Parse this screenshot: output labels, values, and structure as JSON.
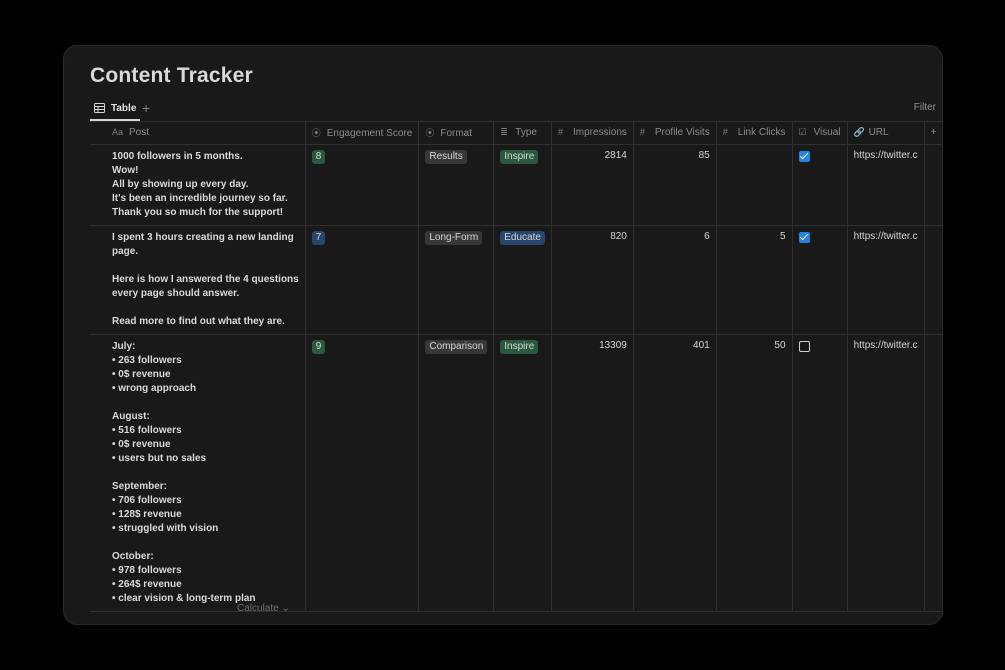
{
  "page": {
    "title": "Content Tracker"
  },
  "toolbar": {
    "view_tab_label": "Table",
    "add_view": "+",
    "filter_label": "Filter"
  },
  "columns": [
    {
      "label": "Post",
      "icon": "Aa"
    },
    {
      "label": "Engagement Score",
      "icon": "⦿"
    },
    {
      "label": "Format",
      "icon": "⦿"
    },
    {
      "label": "Type",
      "icon": "≣"
    },
    {
      "label": "Impressions",
      "icon": "#"
    },
    {
      "label": "Profile Visits",
      "icon": "#"
    },
    {
      "label": "Link Clicks",
      "icon": "#"
    },
    {
      "label": "Visual",
      "icon": "☑"
    },
    {
      "label": "URL",
      "icon": "🔗"
    },
    {
      "label": "+",
      "icon": ""
    }
  ],
  "colors": {
    "score_bg_green": "#2b593f",
    "score_bg_blue": "#28456c",
    "format_bg": "#373737",
    "type_inspire_bg": "#2b593f",
    "type_educate_bg": "#28456c",
    "checkbox_on": "#2383e2"
  },
  "rows": [
    {
      "post": [
        "1000 followers in 5 months.",
        "Wow!",
        "All by showing up every day.",
        "It's been an incredible journey so far.",
        "Thank you so much for the support!"
      ],
      "score": "8",
      "format": "Results",
      "type": "Inspire",
      "impressions": "2814",
      "profile_visits": "85",
      "link_clicks": "",
      "visual": true,
      "url": "https://twitter.c"
    },
    {
      "post": [
        "I spent 3 hours creating a new landing",
        "page.",
        "",
        "Here is how I answered the 4 questions",
        "every page should answer.",
        "",
        "Read more to find out what they are."
      ],
      "score": "7",
      "format": "Long-Form",
      "type": "Educate",
      "impressions": "820",
      "profile_visits": "6",
      "link_clicks": "5",
      "visual": true,
      "url": "https://twitter.c"
    },
    {
      "post": [
        "July:",
        "• 263 followers",
        "• 0$ revenue",
        "• wrong approach",
        "",
        "August:",
        "• 516 followers",
        "• 0$ revenue",
        "• users but no sales",
        "",
        "September:",
        "• 706 followers",
        "• 128$ revenue",
        "• struggled with vision",
        "",
        "October:",
        "• 978 followers",
        "• 264$ revenue",
        "• clear vision & long-term plan"
      ],
      "score": "9",
      "format": "Comparison",
      "type": "Inspire",
      "impressions": "13309",
      "profile_visits": "401",
      "link_clicks": "50",
      "visual": false,
      "url": "https://twitter.c"
    }
  ],
  "footer": {
    "calculate_label": "Calculate ⌄"
  }
}
